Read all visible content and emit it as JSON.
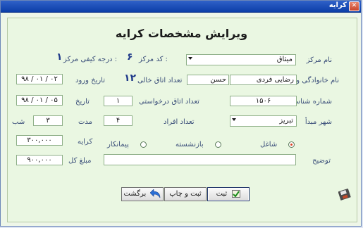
{
  "window": {
    "title": "کرایه",
    "close_glyph": "✕"
  },
  "heading": "ویرایش مشخصات کرایه",
  "center": {
    "label": "نام مرکز",
    "value": "میثاق"
  },
  "center_code": {
    "label": "کد مرکز :",
    "value": "۶"
  },
  "quality": {
    "label": "درجه کیفی مرکز :",
    "value": "۱"
  },
  "name": {
    "label": "نام خانوادگی و نام",
    "last": "رضایی فردی",
    "first": "حسن"
  },
  "free_rooms": {
    "label": "تعداد اتاق خالی",
    "value": "۱۲"
  },
  "entry_date": {
    "label": "تاریخ ورود",
    "value": "۹۸ / ۰۱ / ۰۲"
  },
  "id_number": {
    "label": "شماره شناسنامه",
    "value": "۱۵۰۶"
  },
  "requested_rooms": {
    "label": "تعداد اتاق درخواستی",
    "value": "۱"
  },
  "date": {
    "label": "تاریخ",
    "value": "۹۸ / ۰۱ / ۰۵"
  },
  "origin": {
    "label": "شهر مبدأ",
    "value": "تبریز"
  },
  "people": {
    "label": "تعداد افراد",
    "value": "۴"
  },
  "duration": {
    "label": "مدت",
    "value": "۳",
    "unit": "شب"
  },
  "rent": {
    "label": "کرایه",
    "value": "۳۰۰,۰۰۰"
  },
  "job": {
    "options": [
      "شاغل",
      "بازنشسته",
      "پیمانکار"
    ],
    "selected": "شاغل"
  },
  "description": {
    "label": "توضیح",
    "value": ""
  },
  "total": {
    "label": "مبلغ کل",
    "value": "۹۰۰,۰۰۰"
  },
  "buttons": {
    "save": "ثبت",
    "save_print": "ثبت و چاپ",
    "back": "برگشت"
  }
}
